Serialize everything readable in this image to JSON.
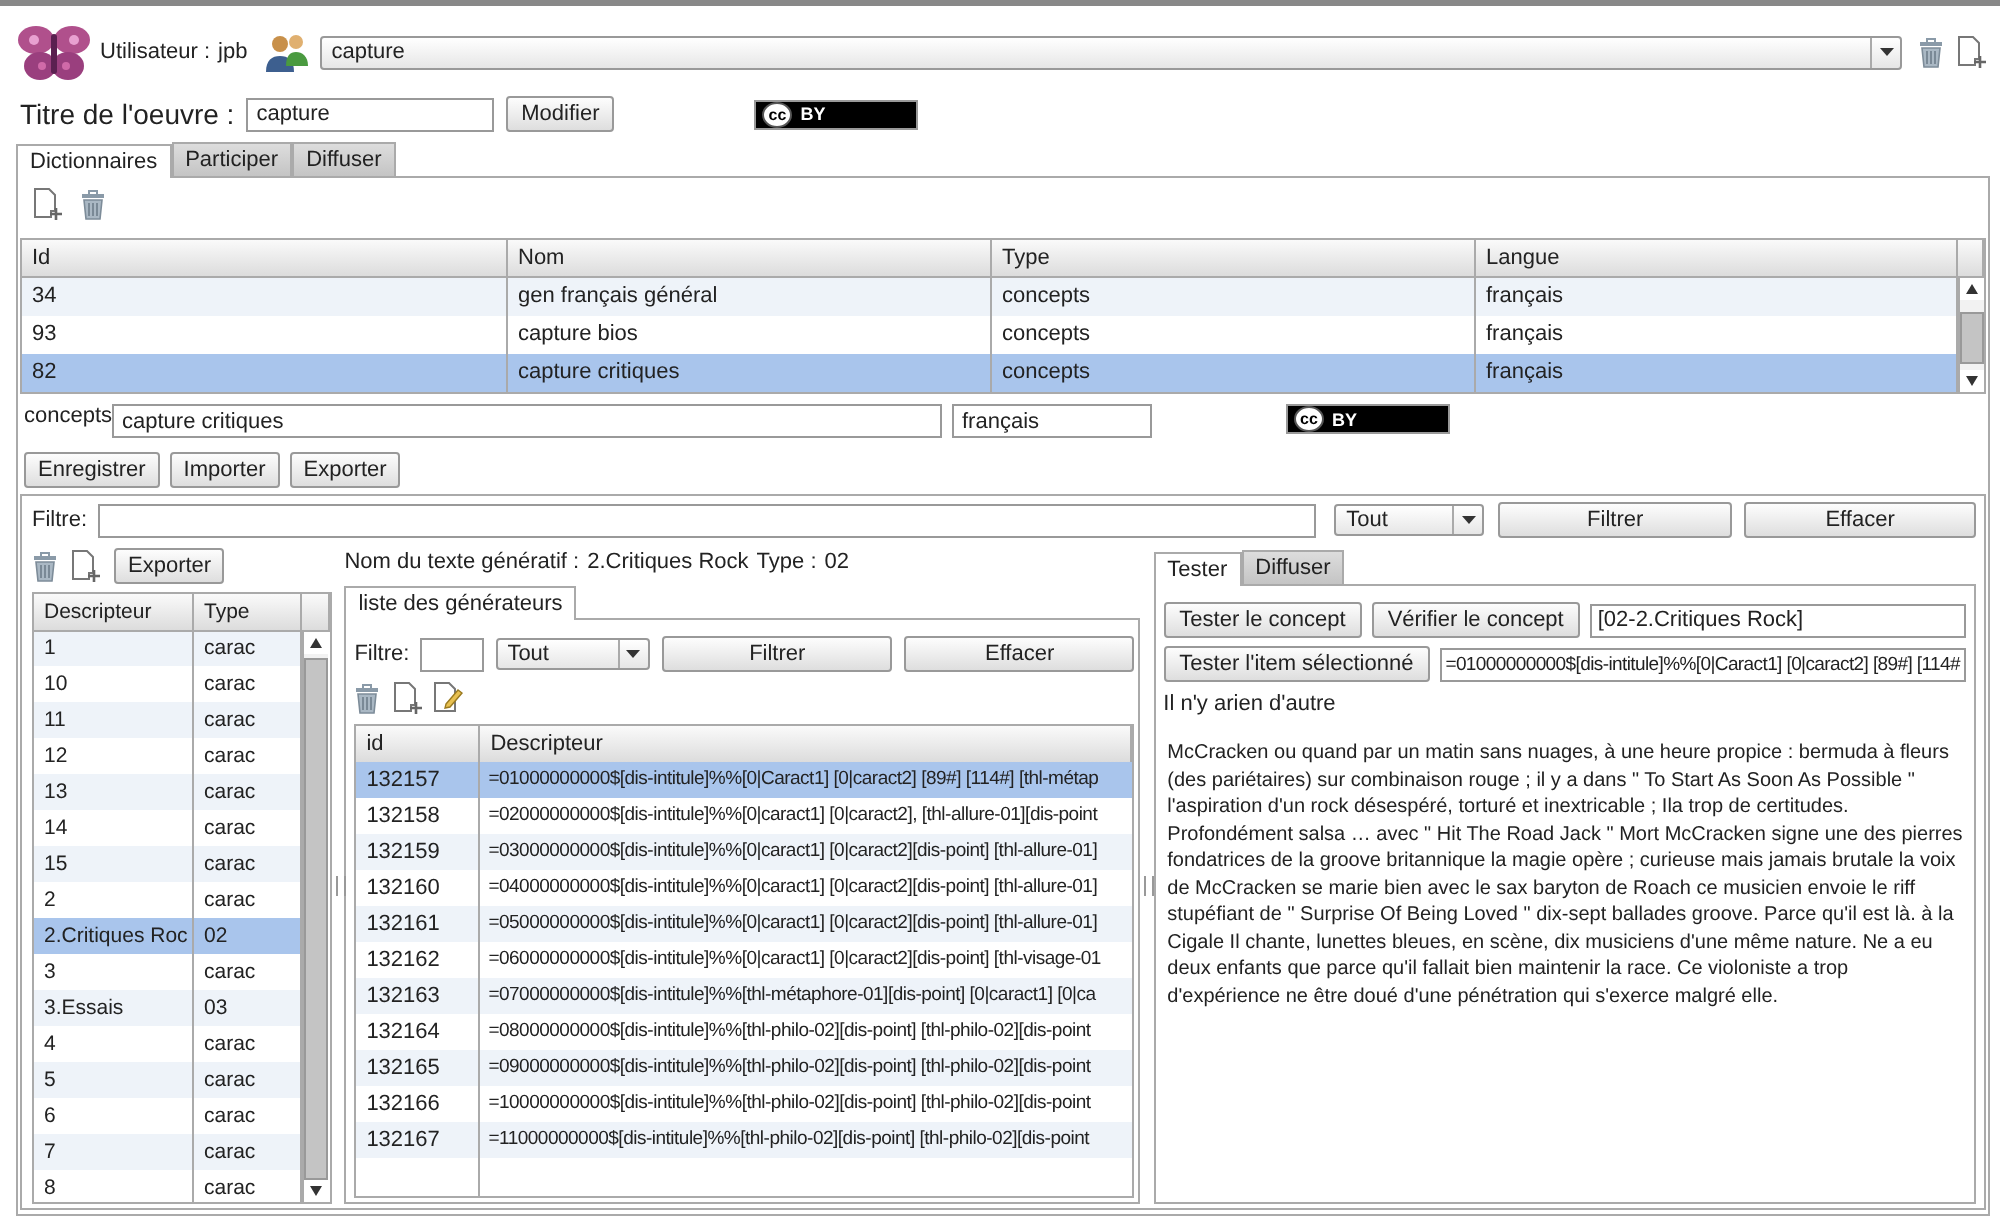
{
  "header": {
    "user_label": "Utilisateur :",
    "user": "jpb",
    "work": "capture"
  },
  "title_row": {
    "label": "Titre de l'oeuvre :",
    "value": "capture",
    "button": "Modifier",
    "license": {
      "mark": "cc",
      "label": "BY"
    }
  },
  "tabs": [
    {
      "label": "Dictionnaires",
      "selected": true
    },
    {
      "label": "Participer",
      "selected": false
    },
    {
      "label": "Diffuser",
      "selected": false
    }
  ],
  "dictionaries": {
    "columns": [
      "Id",
      "Nom",
      "Type",
      "Langue"
    ],
    "rows": [
      {
        "cells": [
          "34",
          "gen français général",
          "concepts",
          "français"
        ],
        "selected": false
      },
      {
        "cells": [
          "93",
          "capture bios",
          "concepts",
          "français"
        ],
        "selected": false
      },
      {
        "cells": [
          "82",
          "capture critiques",
          "concepts",
          "français"
        ],
        "selected": true
      }
    ]
  },
  "concept_editor": {
    "type_label": "concepts",
    "name": "capture critiques",
    "language": "français",
    "license": {
      "mark": "cc",
      "label": "BY"
    },
    "buttons": [
      "Enregistrer",
      "Importer",
      "Exporter"
    ]
  },
  "filter": {
    "label": "Filtre:",
    "select": "Tout",
    "buttons": [
      "Filtrer",
      "Effacer"
    ]
  },
  "descriptors": {
    "export_button": "Exporter",
    "columns": [
      "Descripteur",
      "Type"
    ],
    "rows": [
      {
        "cells": [
          "1",
          "carac"
        ],
        "selected": false
      },
      {
        "cells": [
          "10",
          "carac"
        ],
        "selected": false
      },
      {
        "cells": [
          "11",
          "carac"
        ],
        "selected": false
      },
      {
        "cells": [
          "12",
          "carac"
        ],
        "selected": false
      },
      {
        "cells": [
          "13",
          "carac"
        ],
        "selected": false
      },
      {
        "cells": [
          "14",
          "carac"
        ],
        "selected": false
      },
      {
        "cells": [
          "15",
          "carac"
        ],
        "selected": false
      },
      {
        "cells": [
          "2",
          "carac"
        ],
        "selected": false
      },
      {
        "cells": [
          "2.Critiques Roc",
          "02"
        ],
        "selected": true
      },
      {
        "cells": [
          "3",
          "carac"
        ],
        "selected": false
      },
      {
        "cells": [
          "3.Essais",
          "03"
        ],
        "selected": false
      },
      {
        "cells": [
          "4",
          "carac"
        ],
        "selected": false
      },
      {
        "cells": [
          "5",
          "carac"
        ],
        "selected": false
      },
      {
        "cells": [
          "6",
          "carac"
        ],
        "selected": false
      },
      {
        "cells": [
          "7",
          "carac"
        ],
        "selected": false
      },
      {
        "cells": [
          "8",
          "carac"
        ],
        "selected": false
      }
    ]
  },
  "generative": {
    "name_label": "Nom du texte génératif :",
    "name": "2.Critiques Rock",
    "type_label": "Type :",
    "type": "02",
    "tabs": [
      {
        "label": "liste des générateurs",
        "selected": true
      }
    ],
    "filter": {
      "label": "Filtre:",
      "select": "Tout",
      "buttons": [
        "Filtrer",
        "Effacer"
      ]
    },
    "columns": [
      "id",
      "Descripteur"
    ],
    "rows": [
      {
        "cells": [
          "132157",
          "=01000000000$[dis-intitule]%%[0|Caract1] [0|caract2] [89#] [114#] [thl-métap"
        ],
        "selected": true
      },
      {
        "cells": [
          "132158",
          "=02000000000$[dis-intitule]%%[0|caract1] [0|caract2], [thl-allure-01][dis-point"
        ],
        "selected": false
      },
      {
        "cells": [
          "132159",
          "=03000000000$[dis-intitule]%%[0|caract1] [0|caract2][dis-point] [thl-allure-01]"
        ],
        "selected": false
      },
      {
        "cells": [
          "132160",
          "=04000000000$[dis-intitule]%%[0|caract1] [0|caract2][dis-point] [thl-allure-01]"
        ],
        "selected": false
      },
      {
        "cells": [
          "132161",
          "=05000000000$[dis-intitule]%%[0|caract1] [0|caract2][dis-point] [thl-allure-01]"
        ],
        "selected": false
      },
      {
        "cells": [
          "132162",
          "=06000000000$[dis-intitule]%%[0|caract1] [0|caract2][dis-point] [thl-visage-01"
        ],
        "selected": false
      },
      {
        "cells": [
          "132163",
          "=07000000000$[dis-intitule]%%[thl-métaphore-01][dis-point] [0|caract1] [0|ca"
        ],
        "selected": false
      },
      {
        "cells": [
          "132164",
          "=08000000000$[dis-intitule]%%[thl-philo-02][dis-point] [thl-philo-02][dis-point"
        ],
        "selected": false
      },
      {
        "cells": [
          "132165",
          "=09000000000$[dis-intitule]%%[thl-philo-02][dis-point] [thl-philo-02][dis-point"
        ],
        "selected": false
      },
      {
        "cells": [
          "132166",
          "=10000000000$[dis-intitule]%%[thl-philo-02][dis-point] [thl-philo-02][dis-point"
        ],
        "selected": false
      },
      {
        "cells": [
          "132167",
          "=11000000000$[dis-intitule]%%[thl-philo-02][dis-point] [thl-philo-02][dis-point"
        ],
        "selected": false
      }
    ]
  },
  "tester": {
    "tabs": [
      {
        "label": "Tester",
        "selected": true
      },
      {
        "label": "Diffuser",
        "selected": false
      }
    ],
    "buttons": [
      "Tester le concept",
      "Vérifier le concept"
    ],
    "concept_field": "[02-2.Critiques Rock]",
    "item_button": "Tester l'item sélectionné",
    "item_field": "=01000000000$[dis-intitule]%%[0|Caract1] [0|caract2] [89#] [114#",
    "message": "Il n'y arien d'autre",
    "output": "McCracken ou quand par un matin sans nuages, à une heure propice : bermuda à fleurs (des pariétaires) sur combinaison rouge ; il y a dans \" To Start As Soon As Possible \" l'aspiration d'un rock désespéré, torturé et inextricable ; Ila trop de certitudes. Profondément salsa … avec \" Hit The Road Jack \" Mort McCracken signe une des pierres fondatrices de la groove britannique la magie opère ; curieuse mais jamais brutale la voix de McCracken se marie bien avec le sax baryton de Roach ce musicien envoie le riff stupéfiant de \" Surprise Of Being Loved \" dix-sept ballades groove. Parce qu'il est là. à la Cigale Il chante, lunettes bleues, en scène, dix musiciens d'une même nature. Ne a eu deux enfants que parce qu'il fallait bien maintenir la race. Ce violoniste a trop d'expérience ne être doué d'une pénétration qui s'exerce malgré elle."
  }
}
